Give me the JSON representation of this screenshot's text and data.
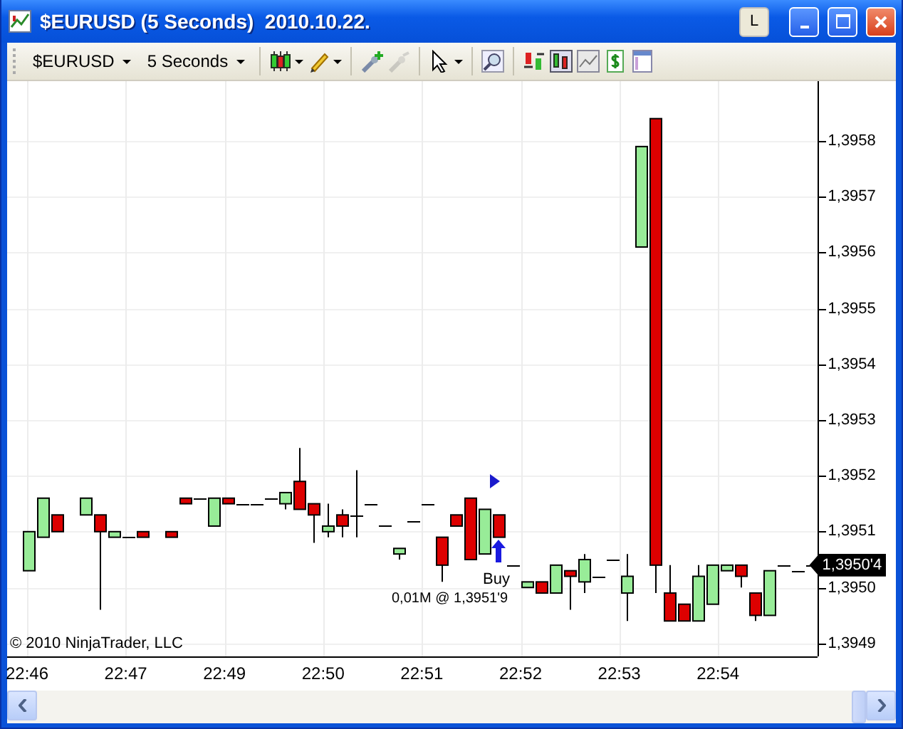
{
  "window": {
    "title": "$EURUSD (5 Seconds)  2010.10.22."
  },
  "title_buttons": [
    {
      "kind": "label",
      "label": "L"
    },
    {
      "kind": "minimize"
    },
    {
      "kind": "maximize"
    },
    {
      "kind": "close"
    }
  ],
  "toolbar": {
    "instrument": "$EURUSD",
    "interval": "5 Seconds",
    "tools": [
      {
        "kind": "candles",
        "dropdown": true,
        "disabled": false
      },
      {
        "kind": "pencil",
        "dropdown": true,
        "disabled": false
      },
      {
        "kind": "wand-plus",
        "dropdown": false,
        "disabled": false
      },
      {
        "kind": "wand",
        "dropdown": false,
        "disabled": true
      },
      {
        "kind": "cursor",
        "dropdown": true,
        "disabled": false
      },
      {
        "kind": "zoom",
        "dropdown": false,
        "disabled": false
      },
      {
        "kind": "bars-arrows",
        "dropdown": false,
        "disabled": false
      },
      {
        "kind": "chart-bars",
        "dropdown": false,
        "disabled": false
      },
      {
        "kind": "line-chart",
        "dropdown": false,
        "disabled": false
      },
      {
        "kind": "dollar",
        "dropdown": false,
        "disabled": false
      },
      {
        "kind": "panel",
        "dropdown": false,
        "disabled": false
      }
    ]
  },
  "chart": {
    "price_ticks": [
      "1,3958",
      "1,3957",
      "1,3956",
      "1,3955",
      "1,3954",
      "1,3953",
      "1,3952",
      "1,3951",
      "1,3950",
      "1,3949"
    ],
    "last_price": "1,3950'4",
    "time_ticks": [
      "22:46",
      "22:47",
      "22:49",
      "22:50",
      "22:51",
      "22:52",
      "22:53",
      "22:54"
    ],
    "copyright": "© 2010 NinjaTrader, LLC",
    "order": {
      "label": "Buy",
      "detail": "0,01M @ 1,3951'9"
    }
  }
}
